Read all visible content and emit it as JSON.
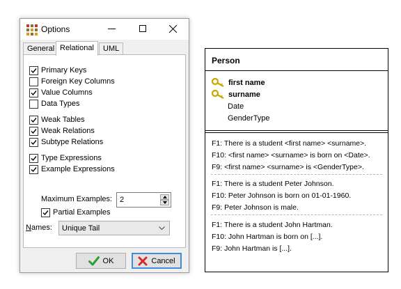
{
  "dialog": {
    "title": "Options",
    "tabs": [
      {
        "label": "General"
      },
      {
        "label": "Relational"
      },
      {
        "label": "UML"
      }
    ],
    "active_tab": "Relational",
    "checkboxes": [
      {
        "label": "Primary Keys",
        "checked": true
      },
      {
        "label": "Foreign Key Columns",
        "checked": false
      },
      {
        "label": "Value Columns",
        "checked": true
      },
      {
        "label": "Data Types",
        "checked": false
      },
      {
        "label": "Weak Tables",
        "checked": true
      },
      {
        "label": "Weak Relations",
        "checked": true
      },
      {
        "label": "Subtype Relations",
        "checked": true
      },
      {
        "label": "Type Expressions",
        "checked": true
      },
      {
        "label": "Example Expressions",
        "checked": true
      }
    ],
    "max_examples": {
      "label": "Maximum Examples:",
      "value": "2"
    },
    "partial_examples": {
      "label": "Partial Examples",
      "checked": true
    },
    "names": {
      "label_accel": "N",
      "label_rest": "ames:",
      "value": "Unique Tail"
    },
    "ok_label": "OK",
    "cancel_label": "Cancel"
  },
  "person": {
    "title": "Person",
    "key_attributes": [
      "first name",
      "surname"
    ],
    "attributes": [
      "Date",
      "GenderType"
    ],
    "example_groups": [
      [
        "F1: There is a student <first name> <surname>.",
        "F10: <first name> <surname> is born on <Date>.",
        "F9: <first name> <surname> is <GenderType>."
      ],
      [
        "F1: There is a student Peter Johnson.",
        "F10: Peter Johnson is born on 01-01-1960.",
        "F9: Peter Johnson is male."
      ],
      [
        "F1: There is a student John Hartman.",
        "F10: John Hartman is born on [...].",
        "F9: John Hartman is [...]."
      ]
    ]
  },
  "colors": {
    "ok_check": "#2e9c2e",
    "cancel_x": "#d42a2a",
    "focus_border": "#3b8fd8",
    "key_icon": "#c8a800"
  }
}
